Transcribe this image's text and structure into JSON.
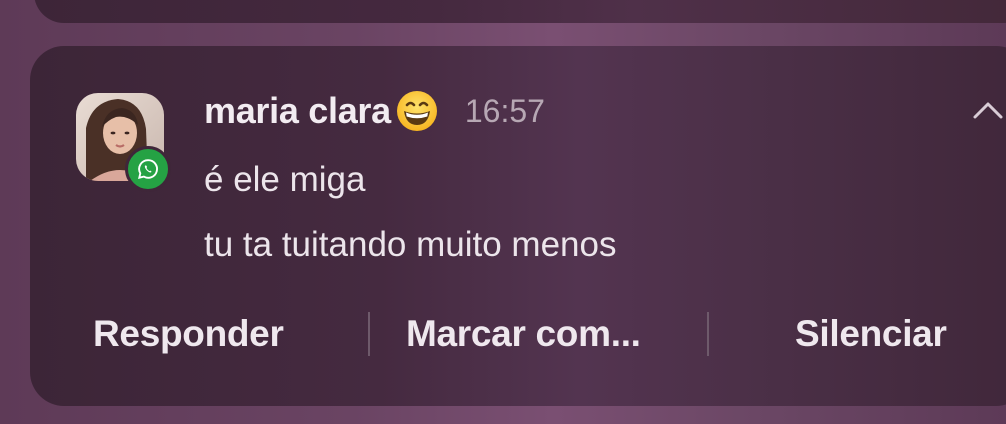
{
  "notification": {
    "app_icon": "whatsapp-icon",
    "sender": "maria clara",
    "sender_emoji": "grinning-face-emoji",
    "time": "16:57",
    "messages": [
      "é ele miga",
      "tu ta tuitando muito menos"
    ],
    "collapse_icon": "chevron-up-icon"
  },
  "actions": [
    {
      "label": "Responder"
    },
    {
      "label": "Marcar com..."
    },
    {
      "label": "Silenciar"
    }
  ],
  "colors": {
    "card_background": "#452a40",
    "app_badge": "#25a244",
    "text_primary": "#f2ecf1",
    "text_secondary": "#b7a8b4"
  }
}
